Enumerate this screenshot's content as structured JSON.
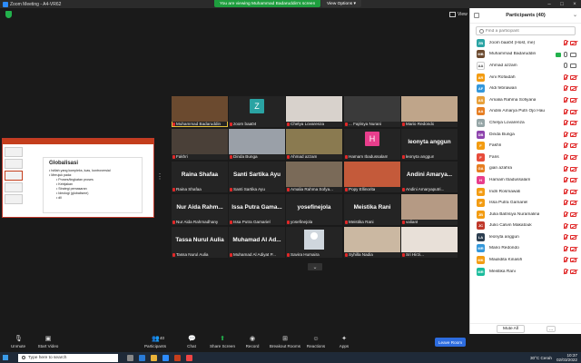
{
  "window": {
    "title": "Zoom Meeting - A4-VR62",
    "banner": "You are viewing Muhammad Badaruddin's screen",
    "view_options": "View Options",
    "view_label": "View",
    "controls": [
      "–",
      "□",
      "×"
    ]
  },
  "slide": {
    "heading": "Globalisasi",
    "bullets": [
      "Istilah yang kompleks, luas, kontroversial",
      "Merujuk pada:"
    ],
    "sub_bullets": [
      "Proses/tingkatan proses",
      "Kebijakan",
      "Strategi pemasaran",
      "Ideologi (globalisme)",
      "dll"
    ]
  },
  "tiles": [
    {
      "name": "Muhammad Badaruddin",
      "kind": "video",
      "color": "#6b4a2f",
      "active": true
    },
    {
      "name": "zoom baa04",
      "kind": "letter",
      "letter": "Z",
      "color": "#2aa3a3"
    },
    {
      "name": "Chelya Lovarenza",
      "kind": "video",
      "color": "#d8d2cc"
    },
    {
      "name": "... Fajrisya Nurani",
      "kind": "video",
      "color": "#3a3a3a"
    },
    {
      "name": "Mario Redondo",
      "kind": "video",
      "color": "#bfa58a"
    },
    {
      "name": "Fakhri",
      "kind": "video",
      "color": "#4a4038"
    },
    {
      "name": "Dinda Bunga",
      "kind": "video",
      "color": "#9aa0a8"
    },
    {
      "name": "Ahmad azzam",
      "kind": "video",
      "color": "#8a7a50"
    },
    {
      "name": "Hamam Ibadussalam",
      "kind": "letter",
      "letter": "H",
      "color": "#e83e8c"
    },
    {
      "name": "leonyta anggun",
      "kind": "text",
      "big": "leonyta anggun"
    },
    {
      "name": "Raina Shafaa",
      "kind": "text",
      "big": "Raina Shafaa"
    },
    {
      "name": "Santi Sartika Ayu",
      "kind": "text",
      "big": "Santi Sartika Ayu"
    },
    {
      "name": "Amalia Rahma Sofya...",
      "kind": "video",
      "color": "#7a6a58"
    },
    {
      "name": "Popy Ellinorita",
      "kind": "video",
      "color": "#c45a3a"
    },
    {
      "name": "Andini Amaryaputri...",
      "kind": "text",
      "big": "Andini Amarya..."
    },
    {
      "name": "Nur Aida Rahmadhany",
      "kind": "text",
      "big": "Nur Aida Rahm..."
    },
    {
      "name": "Issa Putra Gamariel",
      "kind": "text",
      "big": "Issa Putra Gama..."
    },
    {
      "name": "yosefinejola",
      "kind": "text",
      "big": "yosefinejola"
    },
    {
      "name": "Meistika Rani",
      "kind": "text",
      "big": "Meistika Rani"
    },
    {
      "name": "valiant",
      "kind": "video",
      "color": "#b59a84"
    },
    {
      "name": "Tassa Nurul Aulia",
      "kind": "text",
      "big": "Tassa Nurul Aulia"
    },
    {
      "name": "Muhamad Al Adiyat P...",
      "kind": "text",
      "big": "Muhamad Al Ad..."
    },
    {
      "name": "Savira Humaira",
      "kind": "silhouette"
    },
    {
      "name": "Syhilla Nadia",
      "kind": "video",
      "color": "#cbb8a2"
    },
    {
      "name": "Sri Hirzi...",
      "kind": "video",
      "color": "#e8e0d8"
    }
  ],
  "participants": {
    "title": "Participants (40)",
    "search_placeholder": "Find a participant",
    "list": [
      {
        "name": "zoom baa04 (Host, me)",
        "initials": "ZB",
        "color": "#2aa3a3",
        "muted": true,
        "video_off": true
      },
      {
        "name": "Muhammad Badaruddin",
        "initials": "MB",
        "color": "#6b4a2f",
        "sharing": true,
        "muted": false,
        "video_off": false
      },
      {
        "name": "Ahmad azzam",
        "initials": "AA",
        "color": "#ffffff",
        "muted": false,
        "video_off": false,
        "plain": true
      },
      {
        "name": "Aini Rofaidah",
        "initials": "AR",
        "color": "#f39c12",
        "muted": true,
        "video_off": true
      },
      {
        "name": "Aldi febriawan",
        "initials": "AF",
        "color": "#3498db",
        "muted": true,
        "video_off": true
      },
      {
        "name": "Amalia Rahma Sofiyana",
        "initials": "AS",
        "color": "#e8a03a",
        "muted": true,
        "video_off": true
      },
      {
        "name": "Andini Amarya Putri Ojo Hau",
        "initials": "AA",
        "color": "#e67e22",
        "muted": true,
        "video_off": true
      },
      {
        "name": "Chelya Lovarenza",
        "initials": "CL",
        "color": "#95a5a6",
        "muted": true,
        "video_off": true
      },
      {
        "name": "Dinda Bunga",
        "initials": "DB",
        "color": "#8e44ad",
        "muted": true,
        "video_off": true
      },
      {
        "name": "Fakhri",
        "initials": "F",
        "color": "#f39c12",
        "muted": true,
        "video_off": true
      },
      {
        "name": "Faris",
        "initials": "F",
        "color": "#e74c3c",
        "muted": true,
        "video_off": true
      },
      {
        "name": "gian azahra",
        "initials": "GA",
        "color": "#e67e22",
        "muted": true,
        "video_off": true
      },
      {
        "name": "Hamam Ibadussalam",
        "initials": "H",
        "color": "#e83e8c",
        "muted": true,
        "video_off": true
      },
      {
        "name": "Indri Rosmawati",
        "initials": "IR",
        "color": "#f39c12",
        "muted": true,
        "video_off": true
      },
      {
        "name": "Issa Putra Gamariel",
        "initials": "IP",
        "color": "#f39c12",
        "muted": true,
        "video_off": true
      },
      {
        "name": "Julia Batrisiya Nuramalina",
        "initials": "JB",
        "color": "#f39c12",
        "muted": true,
        "video_off": true
      },
      {
        "name": "Julio Calvin Makatouk",
        "initials": "JC",
        "color": "#c0392b",
        "muted": true,
        "video_off": true
      },
      {
        "name": "leonyta anggun",
        "initials": "LA",
        "color": "#2c3e50",
        "muted": true,
        "video_off": true
      },
      {
        "name": "Mario Redondo",
        "initials": "MR",
        "color": "#3498db",
        "muted": true,
        "video_off": true
      },
      {
        "name": "Maulidita Kinasih",
        "initials": "MK",
        "color": "#f39c12",
        "muted": true,
        "video_off": true
      },
      {
        "name": "Meistika Rani",
        "initials": "MR",
        "color": "#1abc9c",
        "muted": true,
        "video_off": true
      }
    ],
    "mute_all": "Mute All",
    "more": "..."
  },
  "toolbar": {
    "unmute": "Unmute",
    "start_video": "Start Video",
    "participants": "Participants",
    "participants_count": "40",
    "chat": "Chat",
    "share_screen": "Share Screen",
    "record": "Record",
    "breakout": "Breakout Rooms",
    "reactions": "Reactions",
    "apps": "Apps",
    "leave": "Leave Room"
  },
  "taskbar": {
    "search": "Type here to search",
    "weather": "30°C  Cerah",
    "time": "10:37",
    "date": "02/03/2022"
  }
}
